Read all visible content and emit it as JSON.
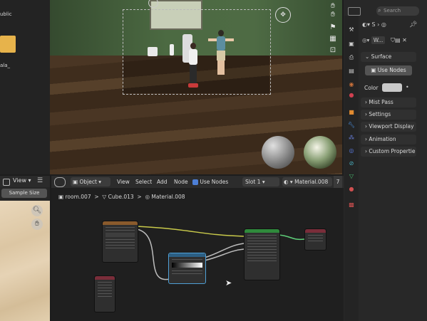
{
  "file_browser": {
    "items": [
      "ublic",
      "ala_"
    ],
    "view_label": "View",
    "sample_size_label": "Sample Size"
  },
  "viewport": {
    "tools": [
      "hand-icon",
      "camera-icon",
      "grid-icon",
      "lock-icon"
    ]
  },
  "node_editor": {
    "header": {
      "mode": "Object",
      "menus": [
        "View",
        "Select",
        "Add",
        "Node"
      ],
      "use_nodes_label": "Use Nodes",
      "use_nodes_checked": true,
      "slot": "Slot 1",
      "material": "Material.008",
      "user_count": "7"
    },
    "breadcrumb": [
      "room.007",
      "Cube.013",
      "Material.008"
    ]
  },
  "properties": {
    "search_placeholder": "Search",
    "material_short": "S",
    "world_short": "W...",
    "panels": {
      "surface": "Surface",
      "use_nodes_button": "Use Nodes",
      "color_label": "Color",
      "mist_pass": "Mist Pass",
      "settings": "Settings",
      "viewport_display": "Viewport Display",
      "animation": "Animation",
      "custom_properties": "Custom Propertie"
    },
    "colors": {
      "accent": "#4d7fd6",
      "swatch": "#c9c9c9"
    }
  }
}
